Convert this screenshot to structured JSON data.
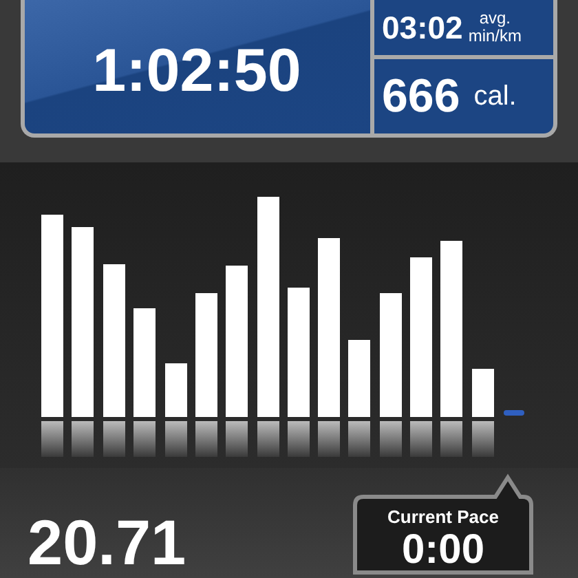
{
  "elapsed_time": "1:02:50",
  "average_pace": {
    "value": "03:02",
    "label": "avg.",
    "unit": "min/km"
  },
  "calories": {
    "value": "666",
    "unit": "cal."
  },
  "distance": "20.71",
  "current_pace": {
    "label": "Current Pace",
    "value": "0:00"
  }
}
